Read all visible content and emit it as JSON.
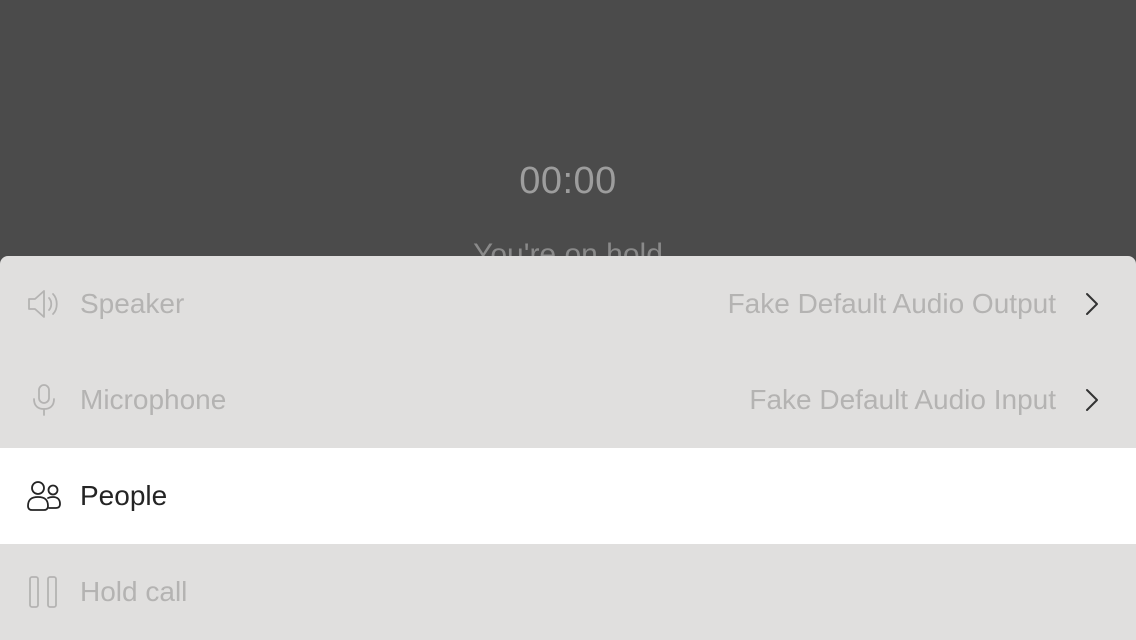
{
  "call": {
    "timer": "00:00",
    "status": "You're on hold"
  },
  "menu": {
    "items": [
      {
        "label": "Speaker",
        "value": "Fake Default Audio Output",
        "icon": "speaker-icon"
      },
      {
        "label": "Microphone",
        "value": "Fake Default Audio Input",
        "icon": "microphone-icon"
      },
      {
        "label": "People",
        "icon": "people-icon"
      },
      {
        "label": "Hold call",
        "icon": "pause-icon"
      }
    ]
  },
  "colors": {
    "background": "#4b4b4b",
    "sheet": "#e0dfde",
    "highlight": "#ffffff",
    "disabled_text": "#b4b3b2",
    "active_text": "#242424"
  }
}
